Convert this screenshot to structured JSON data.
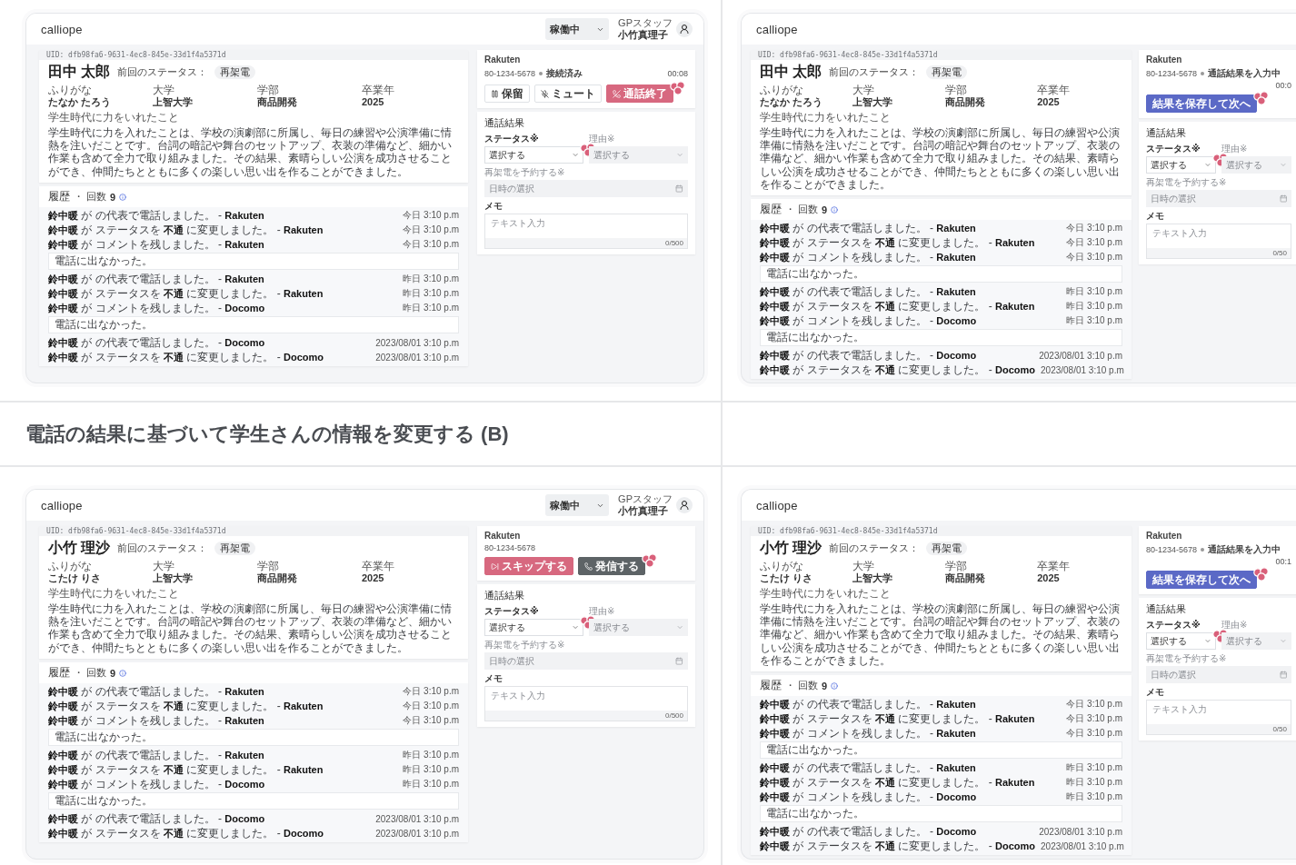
{
  "top_row": [
    {
      "header": {
        "logo": "calliope",
        "status_select": "稼働中",
        "user_role": "GPスタッフ",
        "user_name": "小竹真理子"
      },
      "profile": {
        "uid": "UID: dfb98fa6-9631-4ec8-845e-33d1f4a5371d",
        "name": "田中 太郎",
        "last_status_label": "前回のステータス：",
        "last_status": "再架電",
        "fields": [
          {
            "label": "ふりがな",
            "value": "たなか たろう"
          },
          {
            "label": "大学",
            "value": "上智大学"
          },
          {
            "label": "学部",
            "value": "商品開発"
          },
          {
            "label": "卒業年",
            "value": "2025"
          }
        ],
        "highlight_label": "学生時代に力をいれたこと",
        "highlight_text": "学生時代に力を入れたことは、学校の演劇部に所属し、毎日の練習や公演準備に情熱を注いだことです。台詞の暗記や舞台のセットアップ、衣装の準備など、細かい作業も含めて全力で取り組みました。その結果、素晴らしい公演を成功させることができ、仲間たちとともに多くの楽しい思い出を作ることができました。"
      },
      "history": {
        "title": "履歴",
        "count_label": "・ 回数",
        "count": "9",
        "items": [
          {
            "kind": "event",
            "text": "**鈴中暖** が の代表で電話しました。 - **Rakuten**",
            "time": "今日 3:10 p.m"
          },
          {
            "kind": "event",
            "text": "**鈴中暖** が ステータスを **不通** に変更しました。 - **Rakuten**",
            "time": "今日 3:10 p.m"
          },
          {
            "kind": "event",
            "text": "**鈴中暖** が コメントを残しました。 - **Rakuten**",
            "time": "今日 3:10 p.m"
          },
          {
            "kind": "comment",
            "text": "電話に出なかった。"
          },
          {
            "kind": "event",
            "text": "**鈴中暖** が の代表で電話しました。 - **Rakuten**",
            "time": "昨日 3:10 p.m"
          },
          {
            "kind": "event",
            "text": "**鈴中暖** が ステータスを **不通** に変更しました。 - **Rakuten**",
            "time": "昨日 3:10 p.m"
          },
          {
            "kind": "event",
            "text": "**鈴中暖** が コメントを残しました。 - **Docomo**",
            "time": "昨日 3:10 p.m"
          },
          {
            "kind": "comment",
            "text": "電話に出なかった。"
          },
          {
            "kind": "event",
            "text": "**鈴中暖** が の代表で電話しました。 - **Docomo**",
            "time": "2023/08/01 3:10 p.m"
          },
          {
            "kind": "event",
            "text": "**鈴中暖** が ステータスを **不通** に変更しました。 - **Docomo**",
            "time": "2023/08/01 3:10 p.m"
          }
        ]
      },
      "call": {
        "company": "Rakuten",
        "phone": "80-1234-5678",
        "call_status": "接続済み",
        "timer": "00:08",
        "buttons": [
          {
            "label": "保留",
            "kind": "hold"
          },
          {
            "label": "ミュート",
            "kind": "mute"
          },
          {
            "label": "通話終了",
            "kind": "hangup"
          }
        ]
      },
      "result": {
        "title": "通話結果",
        "fields": [
          {
            "kind": "select",
            "label": "ステータス※",
            "placeholder": "選択する",
            "disabled": false
          },
          {
            "kind": "select",
            "label": "理由※",
            "placeholder": "選択する",
            "disabled": true
          },
          {
            "kind": "date",
            "label": "再架電を予約する※",
            "placeholder": "日時の選択",
            "disabled": true
          },
          {
            "kind": "memo",
            "label": "メモ",
            "placeholder": "テキスト入力",
            "counter": "0/500",
            "disabled": false
          }
        ]
      }
    },
    {
      "header": {
        "logo": "calliope"
      },
      "profile": {
        "uid": "UID: dfb98fa6-9631-4ec8-845e-33d1f4a5371d",
        "name": "田中 太郎",
        "last_status_label": "前回のステータス：",
        "last_status": "再架電",
        "fields": [
          {
            "label": "ふりがな",
            "value": "たなか たろう"
          },
          {
            "label": "大学",
            "value": "上智大学"
          },
          {
            "label": "学部",
            "value": "商品開発"
          },
          {
            "label": "卒業年",
            "value": "2025"
          }
        ],
        "highlight_label": "学生時代に力をいれたこと",
        "highlight_text": "学生時代に力を入れたことは、学校の演劇部に所属し、毎日の練習や公演準備に情熱を注いだことです。台詞の暗記や舞台のセットアップ、衣装の準備など、細かい作業も含めて全力で取り組みました。その結果、素晴らしい公演を成功させることができ、仲間たちとともに多くの楽しい思い出を作ることができました。"
      },
      "history": {
        "title": "履歴",
        "count_label": "・ 回数",
        "count": "9",
        "items": [
          {
            "kind": "event",
            "text": "**鈴中暖** が の代表で電話しました。 - **Rakuten**",
            "time": "今日 3:10 p.m"
          },
          {
            "kind": "event",
            "text": "**鈴中暖** が ステータスを **不通** に変更しました。 - **Rakuten**",
            "time": "今日 3:10 p.m"
          },
          {
            "kind": "event",
            "text": "**鈴中暖** が コメントを残しました。 - **Rakuten**",
            "time": "今日 3:10 p.m"
          },
          {
            "kind": "comment",
            "text": "電話に出なかった。"
          },
          {
            "kind": "event",
            "text": "**鈴中暖** が の代表で電話しました。 - **Rakuten**",
            "time": "昨日 3:10 p.m"
          },
          {
            "kind": "event",
            "text": "**鈴中暖** が ステータスを **不通** に変更しました。 - **Rakuten**",
            "time": "昨日 3:10 p.m"
          },
          {
            "kind": "event",
            "text": "**鈴中暖** が コメントを残しました。 - **Docomo**",
            "time": "昨日 3:10 p.m"
          },
          {
            "kind": "comment",
            "text": "電話に出なかった。"
          },
          {
            "kind": "event",
            "text": "**鈴中暖** が の代表で電話しました。 - **Docomo**",
            "time": "2023/08/01 3:10 p.m"
          },
          {
            "kind": "event",
            "text": "**鈴中暖** が ステータスを **不通** に変更しました。 - **Docomo**",
            "time": "2023/08/01 3:10 p.m"
          }
        ]
      },
      "call": {
        "company": "Rakuten",
        "phone": "80-1234-5678",
        "call_status": "通話結果を入力中",
        "timer": "00:0",
        "buttons": [
          {
            "label": "結果を保存して次へ",
            "kind": "primary"
          }
        ]
      },
      "result": {
        "title": "通話結果",
        "fields": [
          {
            "kind": "select",
            "label": "ステータス※",
            "placeholder": "選択する",
            "disabled": false
          },
          {
            "kind": "select",
            "label": "理由※",
            "placeholder": "選択する",
            "disabled": true
          },
          {
            "kind": "date",
            "label": "再架電を予約する※",
            "placeholder": "日時の選択",
            "disabled": true
          },
          {
            "kind": "memo",
            "label": "メモ",
            "placeholder": "テキスト入力",
            "counter": "0/50",
            "disabled": false
          }
        ]
      }
    }
  ],
  "section_heading": "電話の結果に基づいて学生さんの情報を変更する (B)",
  "bottom_row": [
    {
      "header": {
        "logo": "calliope",
        "status_select": "稼働中",
        "user_role": "GPスタッフ",
        "user_name": "小竹真理子"
      },
      "profile": {
        "uid": "UID: dfb98fa6-9631-4ec8-845e-33d1f4a5371d",
        "name": "小竹 理沙",
        "last_status_label": "前回のステータス：",
        "last_status": "再架電",
        "fields": [
          {
            "label": "ふりがな",
            "value": "こたけ りさ"
          },
          {
            "label": "大学",
            "value": "上智大学"
          },
          {
            "label": "学部",
            "value": "商品開発"
          },
          {
            "label": "卒業年",
            "value": "2025"
          }
        ],
        "highlight_label": "学生時代に力をいれたこと",
        "highlight_text": "学生時代に力を入れたことは、学校の演劇部に所属し、毎日の練習や公演準備に情熱を注いだことです。台詞の暗記や舞台のセットアップ、衣装の準備など、細かい作業も含めて全力で取り組みました。その結果、素晴らしい公演を成功させることができ、仲間たちとともに多くの楽しい思い出を作ることができました。"
      },
      "history": {
        "title": "履歴",
        "count_label": "・ 回数",
        "count": "9",
        "items": [
          {
            "kind": "event",
            "text": "**鈴中暖** が の代表で電話しました。 - **Rakuten**",
            "time": "今日 3:10 p.m"
          },
          {
            "kind": "event",
            "text": "**鈴中暖** が ステータスを **不通** に変更しました。 - **Rakuten**",
            "time": "今日 3:10 p.m"
          },
          {
            "kind": "event",
            "text": "**鈴中暖** が コメントを残しました。 - **Rakuten**",
            "time": "今日 3:10 p.m"
          },
          {
            "kind": "comment",
            "text": "電話に出なかった。"
          },
          {
            "kind": "event",
            "text": "**鈴中暖** が の代表で電話しました。 - **Rakuten**",
            "time": "昨日 3:10 p.m"
          },
          {
            "kind": "event",
            "text": "**鈴中暖** が ステータスを **不通** に変更しました。 - **Rakuten**",
            "time": "昨日 3:10 p.m"
          },
          {
            "kind": "event",
            "text": "**鈴中暖** が コメントを残しました。 - **Docomo**",
            "time": "昨日 3:10 p.m"
          },
          {
            "kind": "comment",
            "text": "電話に出なかった。"
          },
          {
            "kind": "event",
            "text": "**鈴中暖** が の代表で電話しました。 - **Docomo**",
            "time": "2023/08/01 3:10 p.m"
          },
          {
            "kind": "event",
            "text": "**鈴中暖** が ステータスを **不通** に変更しました。 - **Docomo**",
            "time": "2023/08/01 3:10 p.m"
          }
        ]
      },
      "call": {
        "company": "Rakuten",
        "phone": "80-1234-5678",
        "buttons": [
          {
            "label": "スキップする",
            "kind": "skip"
          },
          {
            "label": "発信する",
            "kind": "dial"
          }
        ]
      },
      "result": {
        "title": "通話結果",
        "fields": [
          {
            "kind": "select",
            "label": "ステータス※",
            "placeholder": "選択する",
            "disabled": false
          },
          {
            "kind": "select",
            "label": "理由※",
            "placeholder": "選択する",
            "disabled": true
          },
          {
            "kind": "date",
            "label": "再架電を予約する※",
            "placeholder": "日時の選択",
            "disabled": true
          },
          {
            "kind": "memo",
            "label": "メモ",
            "placeholder": "テキスト入力",
            "counter": "0/500",
            "disabled": false
          }
        ]
      }
    },
    {
      "header": {
        "logo": "calliope"
      },
      "profile": {
        "uid": "UID: dfb98fa6-9631-4ec8-845e-33d1f4a5371d",
        "name": "小竹 理沙",
        "last_status_label": "前回のステータス：",
        "last_status": "再架電",
        "fields": [
          {
            "label": "ふりがな",
            "value": "こたけ りさ"
          },
          {
            "label": "大学",
            "value": "上智大学"
          },
          {
            "label": "学部",
            "value": "商品開発"
          },
          {
            "label": "卒業年",
            "value": "2025"
          }
        ],
        "highlight_label": "学生時代に力をいれたこと",
        "highlight_text": "学生時代に力を入れたことは、学校の演劇部に所属し、毎日の練習や公演準備に情熱を注いだことです。台詞の暗記や舞台のセットアップ、衣装の準備など、細かい作業も含めて全力で取り組みました。その結果、素晴らしい公演を成功させることができ、仲間たちとともに多くの楽しい思い出を作ることができました。"
      },
      "history": {
        "title": "履歴",
        "count_label": "・ 回数",
        "count": "9",
        "items": [
          {
            "kind": "event",
            "text": "**鈴中暖** が の代表で電話しました。 - **Rakuten**",
            "time": "今日 3:10 p.m"
          },
          {
            "kind": "event",
            "text": "**鈴中暖** が ステータスを **不通** に変更しました。 - **Rakuten**",
            "time": "今日 3:10 p.m"
          },
          {
            "kind": "event",
            "text": "**鈴中暖** が コメントを残しました。 - **Rakuten**",
            "time": "今日 3:10 p.m"
          },
          {
            "kind": "comment",
            "text": "電話に出なかった。"
          },
          {
            "kind": "event",
            "text": "**鈴中暖** が の代表で電話しました。 - **Rakuten**",
            "time": "昨日 3:10 p.m"
          },
          {
            "kind": "event",
            "text": "**鈴中暖** が ステータスを **不通** に変更しました。 - **Rakuten**",
            "time": "昨日 3:10 p.m"
          },
          {
            "kind": "event",
            "text": "**鈴中暖** が コメントを残しました。 - **Docomo**",
            "time": "昨日 3:10 p.m"
          },
          {
            "kind": "comment",
            "text": "電話に出なかった。"
          },
          {
            "kind": "event",
            "text": "**鈴中暖** が の代表で電話しました。 - **Docomo**",
            "time": "2023/08/01 3:10 p.m"
          },
          {
            "kind": "event",
            "text": "**鈴中暖** が ステータスを **不通** に変更しました。 - **Docomo**",
            "time": "2023/08/01 3:10 p.m"
          }
        ]
      },
      "call": {
        "company": "Rakuten",
        "phone": "80-1234-5678",
        "call_status": "通話結果を入力中",
        "timer": "00:1",
        "buttons": [
          {
            "label": "結果を保存して次へ",
            "kind": "primary"
          }
        ]
      },
      "result": {
        "title": "通話結果",
        "fields": [
          {
            "kind": "select",
            "label": "ステータス※",
            "placeholder": "選択する",
            "disabled": false
          },
          {
            "kind": "select",
            "label": "理由※",
            "placeholder": "選択する",
            "disabled": true
          },
          {
            "kind": "date",
            "label": "再架電を予約する※",
            "placeholder": "日時の選択",
            "disabled": true
          },
          {
            "kind": "memo",
            "label": "メモ",
            "placeholder": "テキスト入力",
            "counter": "0/50",
            "disabled": false
          }
        ]
      }
    }
  ]
}
